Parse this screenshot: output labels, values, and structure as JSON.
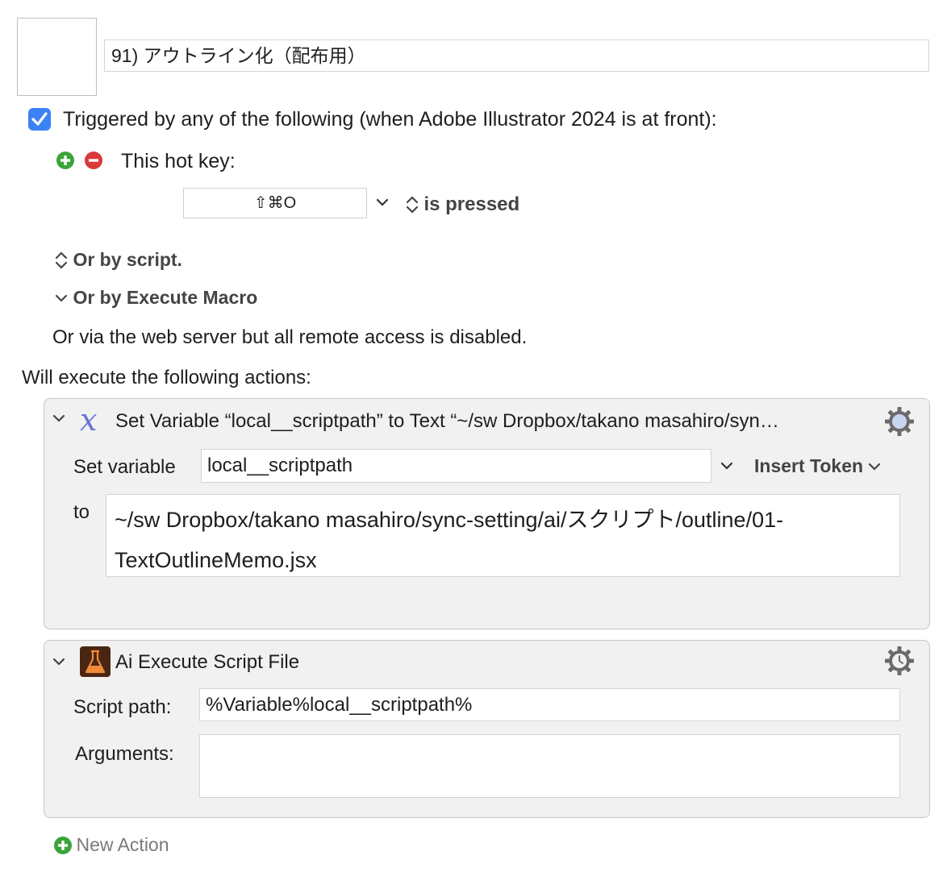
{
  "macro": {
    "name": "91) アウトライン化（配布用）"
  },
  "trigger": {
    "header": "Triggered by any of the following (when Adobe Illustrator 2024 is at front):",
    "hotkey_label": "This hot key:",
    "hotkey_value": "⇧⌘O",
    "condition": "is pressed",
    "or_script": "Or by script.",
    "or_execute_macro": "Or by Execute Macro",
    "web_server": "Or via the web server but all remote access is disabled."
  },
  "actions_header": "Will execute the following actions:",
  "actions": [
    {
      "title": "Set Variable “local__scriptpath” to Text “~/sw Dropbox/takano masahiro/syn…",
      "set_variable_label": "Set variable",
      "variable_name": "local__scriptpath",
      "insert_token": "Insert Token",
      "to_label": "to",
      "text_line1": "~/sw Dropbox/takano masahiro/sync-setting/ai/スクリプト/outline/01-",
      "text_line2": "TextOutlineMemo.jsx"
    },
    {
      "title": "Ai Execute Script File",
      "script_path_label": "Script path:",
      "script_path": "%Variable%local__scriptpath%",
      "arguments_label": "Arguments:",
      "arguments": ""
    }
  ],
  "new_action": "New Action",
  "colors": {
    "checkbox": "#3b82f6",
    "add": "#3aa43a",
    "remove": "#d93a3a",
    "variable_icon": "#6b74d6",
    "script_icon_bg": "#4a2612",
    "script_icon_flask": "#f08a3a"
  }
}
